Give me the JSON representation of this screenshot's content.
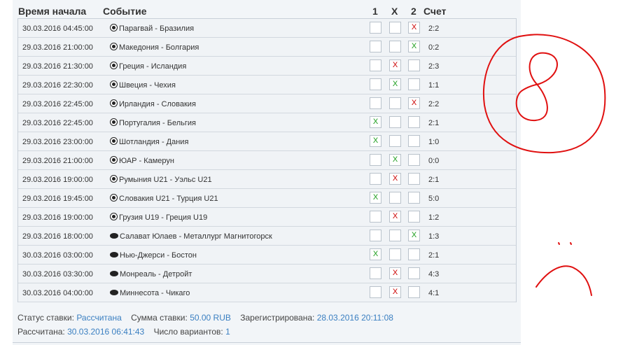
{
  "headers": {
    "time": "Время начала",
    "event": "Событие",
    "col1": "1",
    "colx": "X",
    "col2": "2",
    "score": "Счет"
  },
  "rows": [
    {
      "time": "30.03.2016 04:45:00",
      "event": "Парагвай - Бразилия",
      "sport": "soccer-ball-icon",
      "b1": "",
      "bx": "",
      "b2": "X",
      "mark": "red",
      "col": "b2",
      "score": "2:2"
    },
    {
      "time": "29.03.2016 21:00:00",
      "event": "Македония - Болгария",
      "sport": "soccer-ball-icon",
      "b1": "",
      "bx": "",
      "b2": "X",
      "mark": "green",
      "col": "b2",
      "score": "0:2"
    },
    {
      "time": "29.03.2016 21:30:00",
      "event": "Греция - Исландия",
      "sport": "soccer-ball-icon",
      "b1": "",
      "bx": "X",
      "b2": "",
      "mark": "red",
      "col": "bx",
      "score": "2:3"
    },
    {
      "time": "29.03.2016 22:30:00",
      "event": "Швеция - Чехия",
      "sport": "soccer-ball-icon",
      "b1": "",
      "bx": "X",
      "b2": "",
      "mark": "green",
      "col": "bx",
      "score": "1:1"
    },
    {
      "time": "29.03.2016 22:45:00",
      "event": "Ирландия - Словакия",
      "sport": "soccer-ball-icon",
      "b1": "",
      "bx": "",
      "b2": "X",
      "mark": "red",
      "col": "b2",
      "score": "2:2"
    },
    {
      "time": "29.03.2016 22:45:00",
      "event": "Португалия - Бельгия",
      "sport": "soccer-ball-icon",
      "b1": "X",
      "bx": "",
      "b2": "",
      "mark": "green",
      "col": "b1",
      "score": "2:1"
    },
    {
      "time": "29.03.2016 23:00:00",
      "event": "Шотландия - Дания",
      "sport": "soccer-ball-icon",
      "b1": "X",
      "bx": "",
      "b2": "",
      "mark": "green",
      "col": "b1",
      "score": "1:0"
    },
    {
      "time": "29.03.2016 21:00:00",
      "event": "ЮАР - Камерун",
      "sport": "soccer-ball-icon",
      "b1": "",
      "bx": "X",
      "b2": "",
      "mark": "green",
      "col": "bx",
      "score": "0:0"
    },
    {
      "time": "29.03.2016 19:00:00",
      "event": "Румыния U21 - Уэльс U21",
      "sport": "soccer-ball-icon",
      "b1": "",
      "bx": "X",
      "b2": "",
      "mark": "red",
      "col": "bx",
      "score": "2:1"
    },
    {
      "time": "29.03.2016 19:45:00",
      "event": "Словакия U21 - Турция U21",
      "sport": "soccer-ball-icon",
      "b1": "X",
      "bx": "",
      "b2": "",
      "mark": "green",
      "col": "b1",
      "score": "5:0"
    },
    {
      "time": "29.03.2016 19:00:00",
      "event": "Грузия U19 - Греция U19",
      "sport": "soccer-ball-icon",
      "b1": "",
      "bx": "X",
      "b2": "",
      "mark": "red",
      "col": "bx",
      "score": "1:2"
    },
    {
      "time": "29.03.2016 18:00:00",
      "event": "Салават Юлаев - Металлург Магнитогорск",
      "sport": "hockey-puck-icon",
      "b1": "",
      "bx": "",
      "b2": "X",
      "mark": "green",
      "col": "b2",
      "score": "1:3"
    },
    {
      "time": "30.03.2016 03:00:00",
      "event": "Нью-Джерси - Бостон",
      "sport": "hockey-puck-icon",
      "b1": "X",
      "bx": "",
      "b2": "",
      "mark": "green",
      "col": "b1",
      "score": "2:1"
    },
    {
      "time": "30.03.2016 03:30:00",
      "event": "Монреаль - Детройт",
      "sport": "hockey-puck-icon",
      "b1": "",
      "bx": "X",
      "b2": "",
      "mark": "red",
      "col": "bx",
      "score": "4:3"
    },
    {
      "time": "30.03.2016 04:00:00",
      "event": "Миннесота - Чикаго",
      "sport": "hockey-puck-icon",
      "b1": "",
      "bx": "X",
      "b2": "",
      "mark": "red",
      "col": "bx",
      "score": "4:1"
    }
  ],
  "status": {
    "status_label": "Статус ставки:",
    "status_value": "Рассчитана",
    "sum_label": "Сумма ставки:",
    "sum_value": "50.00 RUB",
    "registered_label": "Зарегистрирована:",
    "registered_value": "28.03.2016 20:11:08",
    "settled_label": "Рассчитана:",
    "settled_value": "30.03.2016 06:41:43",
    "variants_label": "Число вариантов:",
    "variants_value": "1"
  },
  "colors": {
    "red": "#cc0000",
    "green": "#1a9d1a",
    "link": "#3a7fc1",
    "drawing": "#e01010"
  }
}
